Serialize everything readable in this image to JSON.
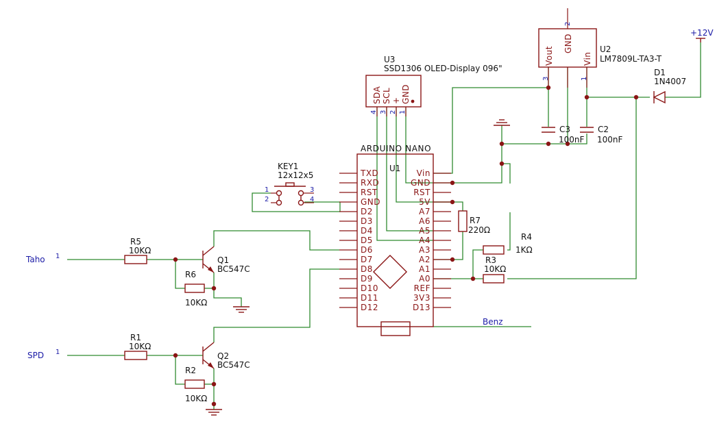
{
  "power": {
    "v12": "+12V"
  },
  "u2": {
    "ref": "U2",
    "value": "LM7809L-TA3-T",
    "pin_vout": "Vout",
    "pin_gnd": "GND",
    "pin_vin": "Vin",
    "n3": "3",
    "n2": "2",
    "n1": "1"
  },
  "u3": {
    "ref": "U3",
    "value": "SSD1306 OLED-Display 096\"",
    "pins": [
      "SDA",
      "SCL",
      "+",
      "GND"
    ],
    "nums": [
      "4",
      "3",
      "2",
      "1"
    ]
  },
  "u1": {
    "ref": "U1",
    "title": "ARDUINO NANO",
    "left_pins": [
      "TXD",
      "RXD",
      "RST",
      "GND",
      "D2",
      "D3",
      "D4",
      "D5",
      "D6",
      "D7",
      "D8",
      "D9",
      "D10",
      "D11",
      "D12"
    ],
    "right_pins": [
      "Vin",
      "GND",
      "RST",
      "5V",
      "A7",
      "A6",
      "A5",
      "A4",
      "A3",
      "A2",
      "A1",
      "A0",
      "REF",
      "3V3",
      "D13"
    ]
  },
  "d1": {
    "ref": "D1",
    "value": "1N4007"
  },
  "c2": {
    "ref": "C2",
    "value": "100nF"
  },
  "c3": {
    "ref": "C3",
    "value": "100nF"
  },
  "key1": {
    "ref": "KEY1",
    "value": "12x12x5",
    "p1": "1",
    "p2": "2",
    "p3": "3",
    "p4": "4"
  },
  "r1": {
    "ref": "R1",
    "value": "10KΩ"
  },
  "r2": {
    "ref": "R2",
    "value": "10KΩ"
  },
  "r3": {
    "ref": "R3",
    "value": "10KΩ"
  },
  "r4": {
    "ref": "R4",
    "value": "1KΩ"
  },
  "r5": {
    "ref": "R5",
    "value": "10KΩ"
  },
  "r6": {
    "ref": "R6",
    "value": "10KΩ"
  },
  "r7": {
    "ref": "R7",
    "value": "220Ω"
  },
  "q1": {
    "ref": "Q1",
    "value": "BC547C"
  },
  "q2": {
    "ref": "Q2",
    "value": "BC547C"
  },
  "connectors": {
    "taho": "Taho",
    "taho_pin": "1",
    "spd": "SPD",
    "spd_pin": "1",
    "benz": "Benz"
  }
}
